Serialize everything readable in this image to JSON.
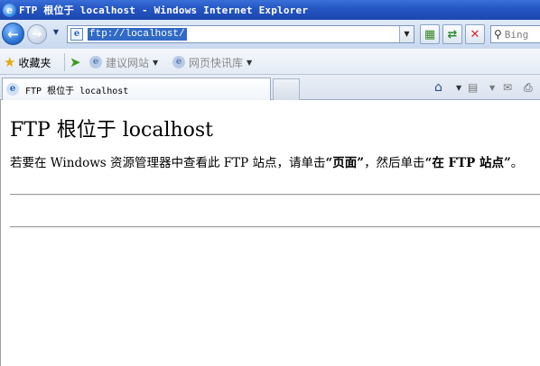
{
  "window": {
    "title": "FTP 根位于 localhost - Windows Internet Explorer"
  },
  "address_bar": {
    "url": "ftp://localhost/",
    "search_placeholder": "Bing"
  },
  "favorites_bar": {
    "favorites_label": "收藏夹",
    "items": [
      {
        "label": "建议网站",
        "icon": "ie-page-icon"
      },
      {
        "label": "网页快讯库",
        "icon": "ie-page-icon"
      }
    ]
  },
  "tab": {
    "label": "FTP 根位于 localhost"
  },
  "page": {
    "heading": "FTP 根位于 localhost",
    "instruction_parts": {
      "part1": "若要在 Windows 资源管理器中查看此 FTP 站点，请单击",
      "bold1": "“页面”",
      "part2": "，然后单击",
      "bold2": "“在 FTP 站点”",
      "part3": "。"
    }
  },
  "colors": {
    "titlebar": "#2455c3",
    "selection": "#316ac5",
    "toolbar": "#dfe9f7"
  }
}
